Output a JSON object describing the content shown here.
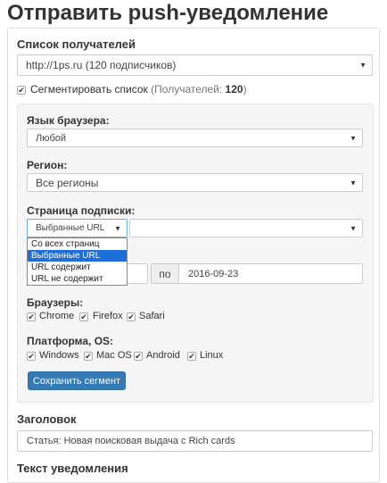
{
  "page": {
    "title": "Отправить push-уведомление"
  },
  "recipients": {
    "label": "Список получателей",
    "selected": "http://1ps.ru (120 подписчиков)"
  },
  "segment": {
    "checkbox_label": "Сегментировать список",
    "count_prefix": "(Получателей: ",
    "count": "120",
    "count_suffix": ")",
    "checked": true
  },
  "browser_language": {
    "label": "Язык браузера:",
    "selected": "Любой"
  },
  "region": {
    "label": "Регион:",
    "selected": "Все регионы"
  },
  "subscription_page": {
    "label": "Страница подписки:",
    "selected": "Выбранные URL",
    "second_value": "",
    "options": [
      "Со всех страниц",
      "Выбранные URL",
      "URL содержит",
      "URL не содержит"
    ],
    "highlighted_index": 1
  },
  "date": {
    "to_label": "по",
    "to_value": "2016-09-23"
  },
  "browsers": {
    "label": "Браузеры:",
    "items": [
      {
        "label": "Chrome",
        "checked": true
      },
      {
        "label": "Firefox",
        "checked": true
      },
      {
        "label": "Safari",
        "checked": true
      }
    ]
  },
  "platforms": {
    "label": "Платформа, OS:",
    "items": [
      {
        "label": "Windows",
        "checked": true
      },
      {
        "label": "Mac OS",
        "checked": true
      },
      {
        "label": "Android",
        "checked": true
      },
      {
        "label": "Linux",
        "checked": true
      }
    ]
  },
  "save_segment": {
    "label": "Сохранить сегмент"
  },
  "heading": {
    "label": "Заголовок",
    "value": "Статья: Новая поисковая выдача с Rich cards"
  },
  "notification_text": {
    "label": "Текст уведомления"
  },
  "icons": {
    "caret": "caret-down-icon",
    "check": "check-icon"
  },
  "colors": {
    "primary": "#337ab7",
    "highlight": "#1e6fd9",
    "panel": "#f5f5f5"
  }
}
